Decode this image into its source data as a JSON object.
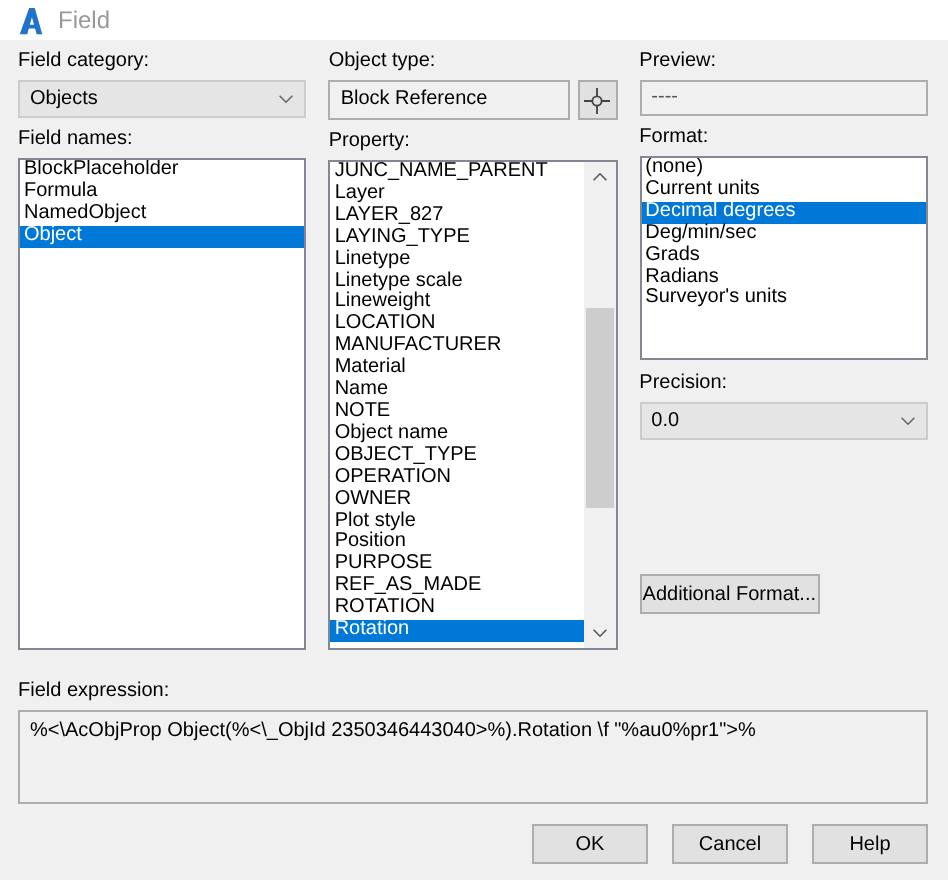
{
  "window": {
    "title": "Field"
  },
  "field_category": {
    "label": "Field category:",
    "value": "Objects"
  },
  "field_names": {
    "label": "Field names:",
    "items": [
      {
        "text": "BlockPlaceholder",
        "selected": false
      },
      {
        "text": "Formula",
        "selected": false
      },
      {
        "text": "NamedObject",
        "selected": false
      },
      {
        "text": "Object",
        "selected": true
      }
    ]
  },
  "object_type": {
    "label": "Object type:",
    "value": "Block Reference"
  },
  "property": {
    "label": "Property:",
    "items": [
      {
        "text": "JUNC_NAME_PARENT",
        "selected": false
      },
      {
        "text": "Layer",
        "selected": false
      },
      {
        "text": "LAYER_827",
        "selected": false
      },
      {
        "text": "LAYING_TYPE",
        "selected": false
      },
      {
        "text": "Linetype",
        "selected": false
      },
      {
        "text": "Linetype scale",
        "selected": false
      },
      {
        "text": "Lineweight",
        "selected": false
      },
      {
        "text": "LOCATION",
        "selected": false
      },
      {
        "text": "MANUFACTURER",
        "selected": false
      },
      {
        "text": "Material",
        "selected": false
      },
      {
        "text": "Name",
        "selected": false
      },
      {
        "text": "NOTE",
        "selected": false
      },
      {
        "text": "Object name",
        "selected": false
      },
      {
        "text": "OBJECT_TYPE",
        "selected": false
      },
      {
        "text": "OPERATION",
        "selected": false
      },
      {
        "text": "OWNER",
        "selected": false
      },
      {
        "text": "Plot style",
        "selected": false
      },
      {
        "text": "Position",
        "selected": false
      },
      {
        "text": "PURPOSE",
        "selected": false
      },
      {
        "text": "REF_AS_MADE",
        "selected": false
      },
      {
        "text": "ROTATION",
        "selected": false
      },
      {
        "text": "Rotation",
        "selected": true
      }
    ]
  },
  "preview": {
    "label": "Preview:",
    "value": "----"
  },
  "format": {
    "label": "Format:",
    "items": [
      {
        "text": "(none)",
        "selected": false
      },
      {
        "text": "Current units",
        "selected": false
      },
      {
        "text": "Decimal degrees",
        "selected": true
      },
      {
        "text": "Deg/min/sec",
        "selected": false
      },
      {
        "text": "Grads",
        "selected": false
      },
      {
        "text": "Radians",
        "selected": false
      },
      {
        "text": "Surveyor's units",
        "selected": false
      }
    ]
  },
  "precision": {
    "label": "Precision:",
    "value": "0.0"
  },
  "additional_format_button": "Additional Format...",
  "field_expression": {
    "label": "Field expression:",
    "value": "%<\\AcObjProp Object(%<\\_ObjId 2350346443040>%).Rotation \\f \"%au0%pr1\">%"
  },
  "buttons": [
    "OK",
    "Cancel",
    "Help"
  ]
}
